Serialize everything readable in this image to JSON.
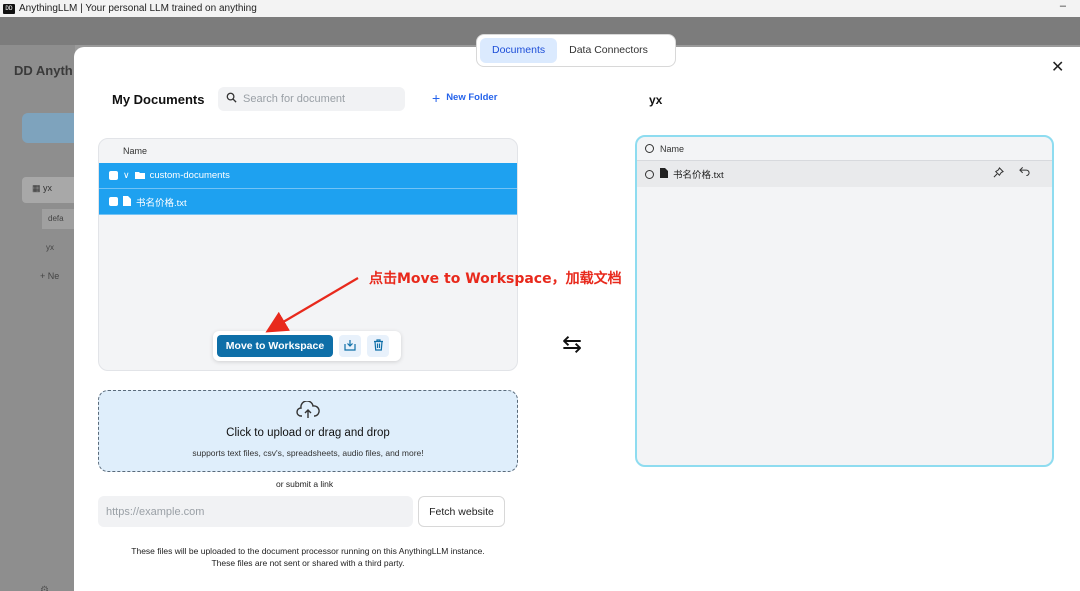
{
  "window": {
    "icon_text": "DD",
    "title": "AnythingLLM | Your personal LLM trained on anything",
    "minimize": "–"
  },
  "background": {
    "logo": "DD Anyth",
    "workspace": "yx",
    "default": "defa",
    "thread": "yx",
    "new": "+  Ne"
  },
  "tabs": [
    {
      "label": "Documents",
      "active": true
    },
    {
      "label": "Data Connectors",
      "active": false
    }
  ],
  "left_panel": {
    "title": "My Documents",
    "search_placeholder": "Search for document",
    "new_folder_label": "New Folder",
    "column_name": "Name",
    "items": [
      {
        "type": "folder",
        "label": "custom-documents",
        "selected": true
      },
      {
        "type": "file",
        "label": "书名价格.txt",
        "selected": true
      }
    ],
    "move_button": "Move to Workspace"
  },
  "annotation": "点击Move to Workspace，加载文档",
  "upload": {
    "title": "Click to upload or drag and drop",
    "subtitle": "supports text files, csv's, spreadsheets, audio files, and more!",
    "or_link": "or submit a link",
    "url_placeholder": "https://example.com",
    "fetch_button": "Fetch website",
    "notice_line1": "These files will be uploaded to the document processor running on this AnythingLLM instance.",
    "notice_line2": "These files are not sent or shared with a third party."
  },
  "workspace_panel": {
    "title": "yx",
    "column_name": "Name",
    "items": [
      {
        "type": "file",
        "label": "书名价格.txt"
      }
    ]
  },
  "colors": {
    "accent": "#1ea1f0",
    "primary_button": "#0e6fa8",
    "annotation": "#e8291c",
    "workspace_border": "#8edcf0"
  }
}
